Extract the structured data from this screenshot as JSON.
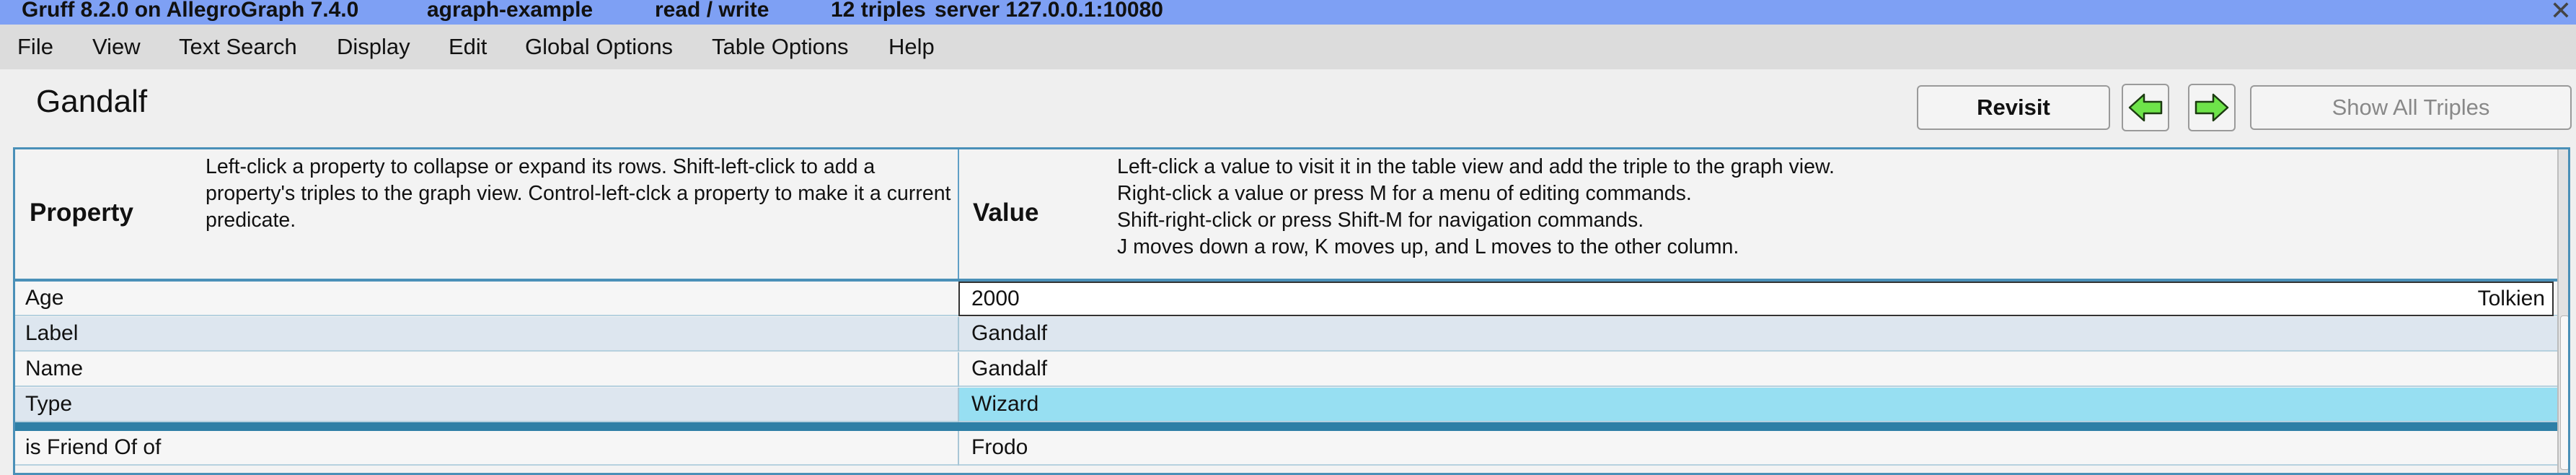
{
  "titlebar": {
    "app": "Gruff 8.2.0 on AllegroGraph 7.4.0",
    "repository": "agraph-example",
    "mode": "read / write",
    "triples": "12 triples",
    "server": "server 127.0.0.1:10080",
    "close_glyph": "✕"
  },
  "menu": [
    "File",
    "View",
    "Text Search",
    "Display",
    "Edit",
    "Global Options",
    "Table Options",
    "Help"
  ],
  "toolbar": {
    "subject": "Gandalf",
    "revisit": "Revisit",
    "show_all": "Show All Triples"
  },
  "table": {
    "property_header": "Property",
    "property_help": "Left-click a property to collapse or expand its rows.  Shift-left-click to add a property's triples to the graph view.  Control-left-clck a property to make it a current predicate.",
    "value_header": "Value",
    "value_help": [
      "Left-click a value to visit it in the table view and add the triple to the graph view.",
      "Right-click a value or press M for a menu of editing commands.",
      "Shift-right-click or press Shift-M for navigation commands.",
      "J moves down a row, K moves up, and L moves to the other column."
    ],
    "rows": [
      {
        "property": "Age",
        "value": "2000",
        "source": "Tolkien"
      },
      {
        "property": "Label",
        "value": "Gandalf"
      },
      {
        "property": "Name",
        "value": "Gandalf"
      },
      {
        "property": "Type",
        "value": "Wizard"
      },
      {
        "property": "is Friend Of of",
        "value": "Frodo"
      }
    ]
  },
  "colors": {
    "titlebar": "#7ea0f4",
    "accent": "#4a90b8",
    "highlight": "#97dff2",
    "arrow_green": "#6ee34a"
  }
}
